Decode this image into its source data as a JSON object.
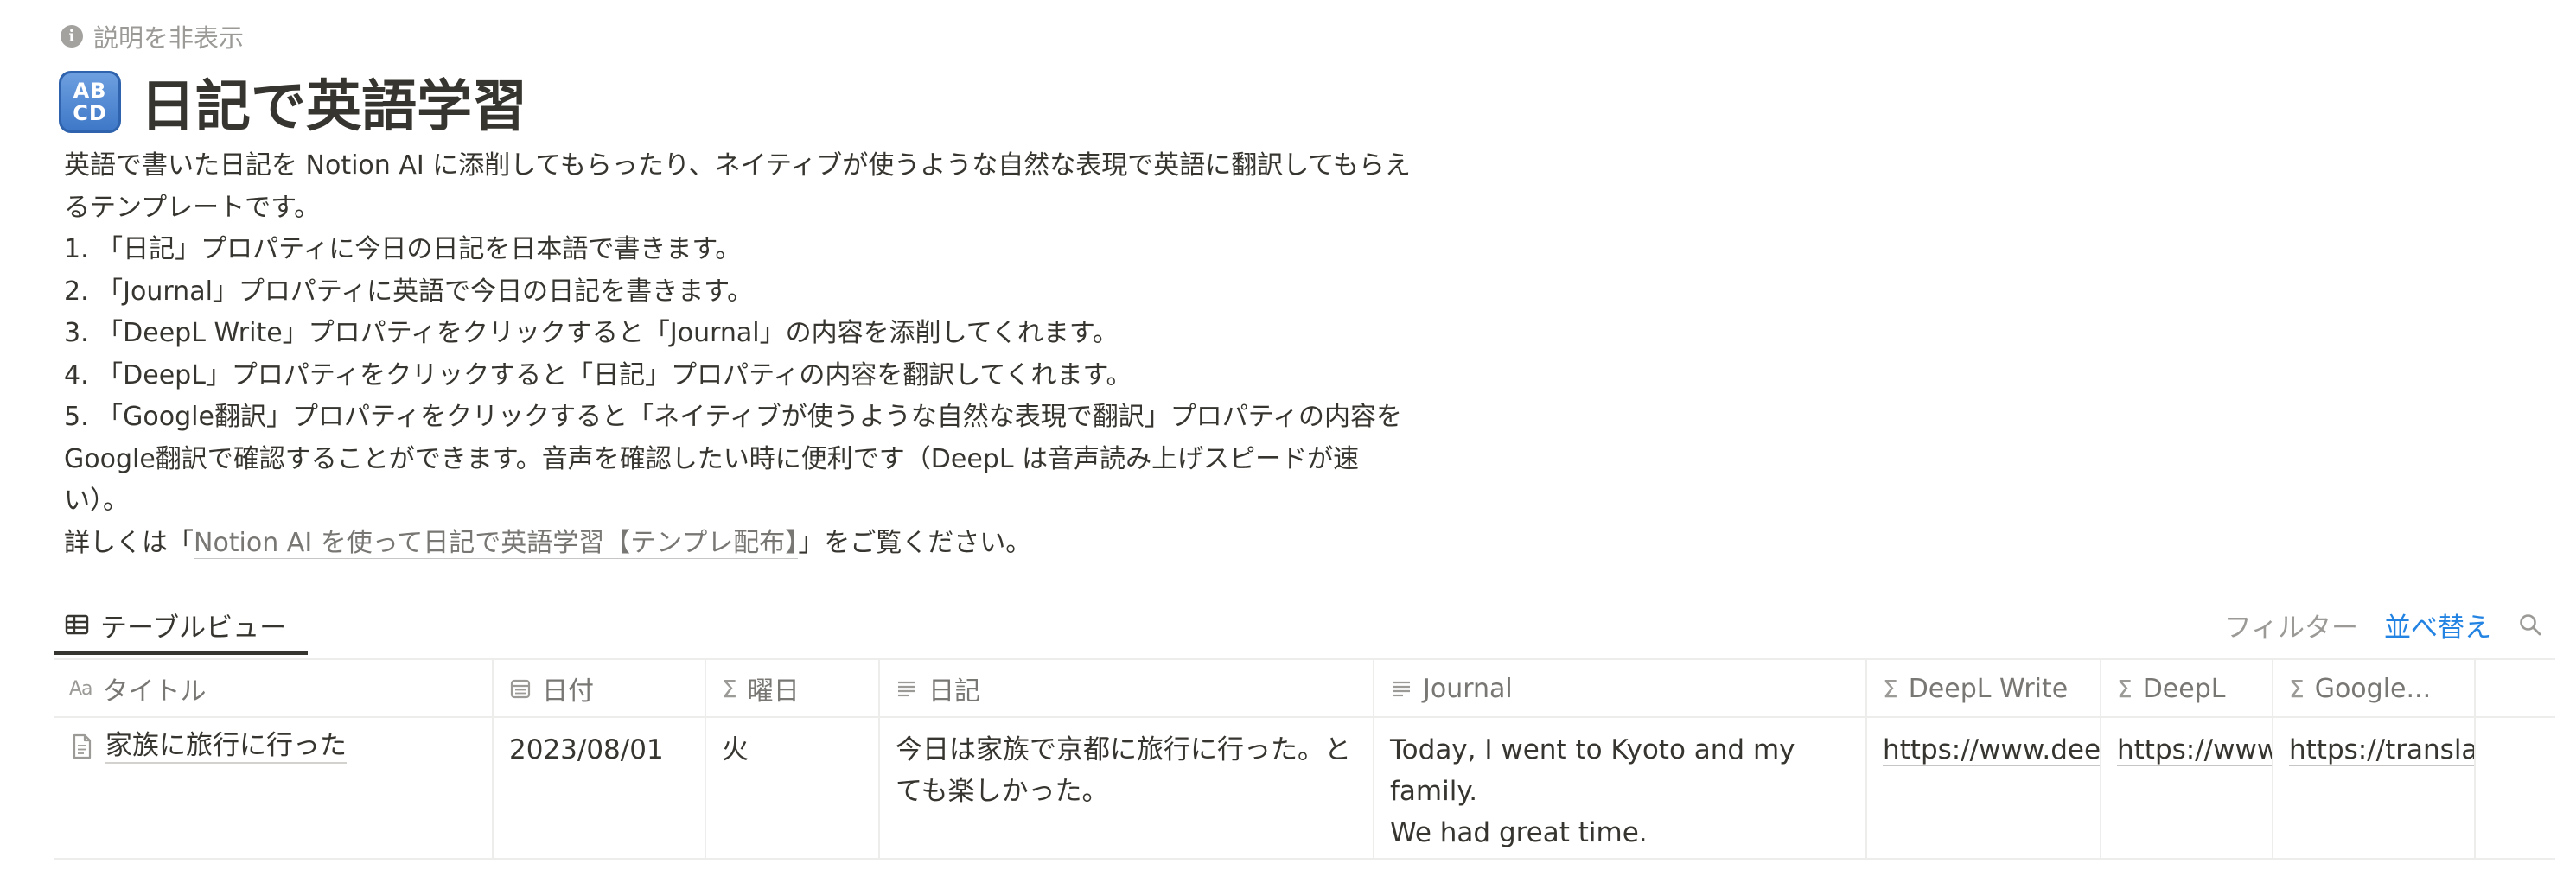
{
  "page": {
    "hide_description": "説明を非表示",
    "emoji_line1": "AB",
    "emoji_line2": "CD",
    "title": "日記で英語学習",
    "description": [
      "英語で書いた日記を Notion AI に添削してもらったり、ネイティブが使うような自然な表現で英語に翻訳してもらえるテンプレートです。",
      "1. 「日記」プロパティに今日の日記を日本語で書きます。",
      "2. 「Journal」プロパティに英語で今日の日記を書きます。",
      "3. 「DeepL Write」プロパティをクリックすると「Journal」の内容を添削してくれます。",
      "4. 「DeepL」プロパティをクリックすると「日記」プロパティの内容を翻訳してくれます。",
      "5. 「Google翻訳」プロパティをクリックすると「ネイティブが使うような自然な表現で翻訳」プロパティの内容をGoogle翻訳で確認することができます。音声を確認したい時に便利です（DeepL は音声読み上げスピードが速い）。"
    ],
    "detail_prefix": "詳しくは「",
    "detail_link": "Notion AI を使って日記で英語学習【テンプレ配布】",
    "detail_suffix": "」をご覧ください。"
  },
  "view": {
    "tab_label": "テーブルビュー",
    "filter_label": "フィルター",
    "sort_label": "並べ替え"
  },
  "table": {
    "columns": [
      {
        "icon": "Aa",
        "label": "タイトル"
      },
      {
        "icon": "calendar-icon",
        "label": "日付"
      },
      {
        "icon": "Σ",
        "label": "曜日"
      },
      {
        "icon": "text-lines-icon",
        "label": "日記"
      },
      {
        "icon": "text-lines-icon",
        "label": "Journal"
      },
      {
        "icon": "Σ",
        "label": "DeepL Write"
      },
      {
        "icon": "Σ",
        "label": "DeepL"
      },
      {
        "icon": "Σ",
        "label": "Google..."
      }
    ],
    "rows": [
      {
        "title": "家族に旅行に行った",
        "date": "2023/08/01",
        "weekday": "火",
        "diary": "今日は家族で京都に旅行に行った。とても楽しかった。",
        "journal_line1": "Today, I went to Kyoto and my family.",
        "journal_line2": "We had great time.",
        "deepl_write": "https://www.deepl.com/write",
        "deepl": "https://www.deepl.com/translator",
        "google": "https://translate.google.com/"
      }
    ]
  },
  "colors": {
    "text": "#37352f",
    "muted": "#787774",
    "accent": "#2383e2",
    "border": "#ededec"
  }
}
